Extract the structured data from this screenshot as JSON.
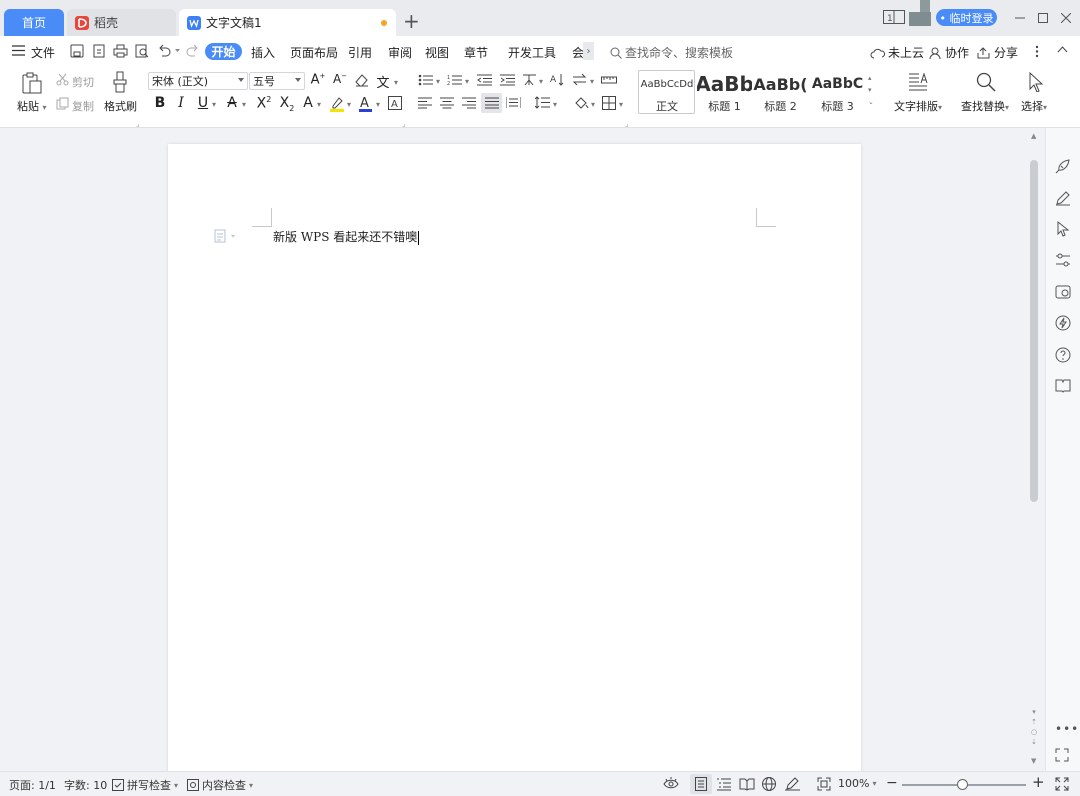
{
  "tabs": {
    "home": "首页",
    "daoke": "稻壳",
    "doc": "文字文稿1",
    "login": "• 临时登录"
  },
  "menubar": {
    "file": "文件",
    "start": "开始",
    "items": [
      "插入",
      "页面布局",
      "引用",
      "审阅",
      "视图",
      "章节",
      "开发工具",
      "会"
    ],
    "search_placeholder": "查找命令、搜索模板",
    "cloud": "未上云",
    "collab": "协作",
    "share": "分享"
  },
  "ribbon": {
    "paste": "粘贴",
    "cut": "剪切",
    "copy": "复制",
    "format_painter": "格式刷",
    "font_name": "宋体 (正文)",
    "font_size": "五号",
    "styles": [
      {
        "preview": "AaBbCcDd",
        "name": "正文"
      },
      {
        "preview": "AaBb",
        "name": "标题 1"
      },
      {
        "preview": "AaBb(",
        "name": "标题 2"
      },
      {
        "preview": "AaBbC",
        "name": "标题 3"
      }
    ],
    "text_layout": "文字排版",
    "find_replace": "查找替换",
    "select": "选择"
  },
  "document": {
    "text": "新版 WPS 看起来还不错噢"
  },
  "status": {
    "page": "页面: 1/1",
    "words": "字数: 10",
    "spell": "拼写检查",
    "content_check": "内容检查",
    "zoom": "100%",
    "zoom_level": 0.48
  },
  "colors": {
    "accent": "#4a8cf7",
    "tab_modified": "#f5a524",
    "highlight": "#f2e600",
    "font_color": "#2b3fd6"
  }
}
